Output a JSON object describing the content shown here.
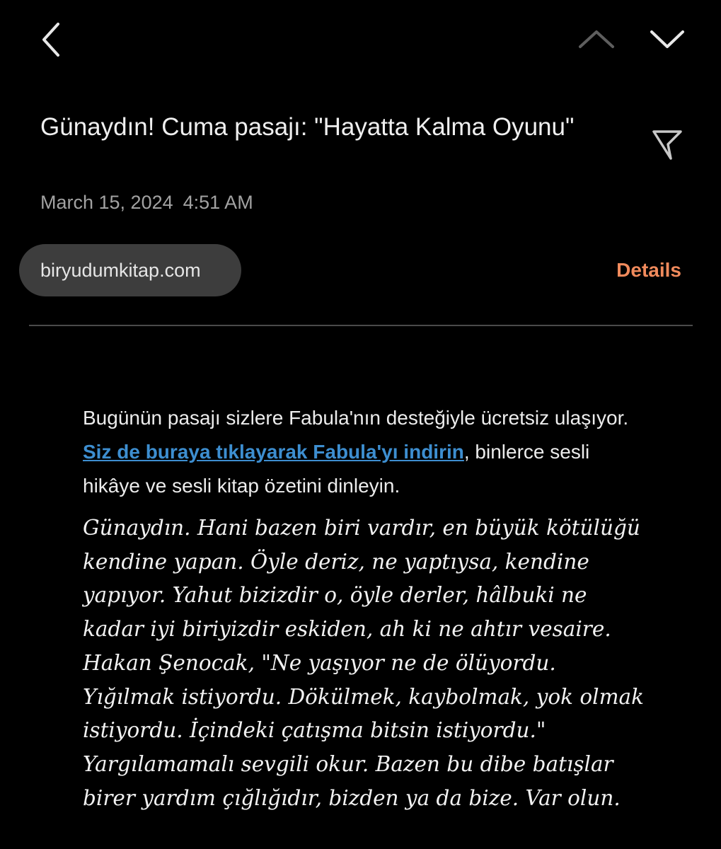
{
  "toolbar": {
    "back_icon": "chevron-left-icon",
    "prev_icon": "chevron-up-icon",
    "next_icon": "chevron-down-icon",
    "flag_icon": "flag-icon"
  },
  "email": {
    "subject": "Günaydın! Cuma pasajı: \"Hayatta Kalma Oyunu\"",
    "date": "March 15, 2024",
    "time": "4:51 AM",
    "sender": "biryudumkitap.com",
    "details_label": "Details"
  },
  "body": {
    "intro_before": "Bugünün pasajı sizlere Fabula'nın desteğiyle ücretsiz ulaşıyor. ",
    "link_text": "Siz de buraya tıklayarak Fabula'yı indirin",
    "intro_after": ", binlerce sesli hikâye ve sesli kitap özetini dinleyin.",
    "passage": "Günaydın. Hani bazen biri vardır, en büyük kötülüğü kendine yapan. Öyle deriz, ne yaptıysa, kendine yapıyor. Yahut bizizdir o, öyle derler, hâlbuki ne kadar iyi biriyizdir eskiden, ah ki ne ahtır vesaire. Hakan Şenocak, \"Ne yaşıyor ne de ölüyordu. Yığılmak istiyordu. Dökülmek, kaybolmak, yok olmak istiyordu. İçindeki çatışma bitsin istiyordu.\" Yargılamamalı sevgili okur. Bazen bu dibe batışlar birer yardım çığlığıdır, bizden ya da bize. Var olun."
  },
  "colors": {
    "background": "#000000",
    "accent": "#f08a5c",
    "link": "#3d8ed0",
    "chip": "#3d3d3d"
  }
}
